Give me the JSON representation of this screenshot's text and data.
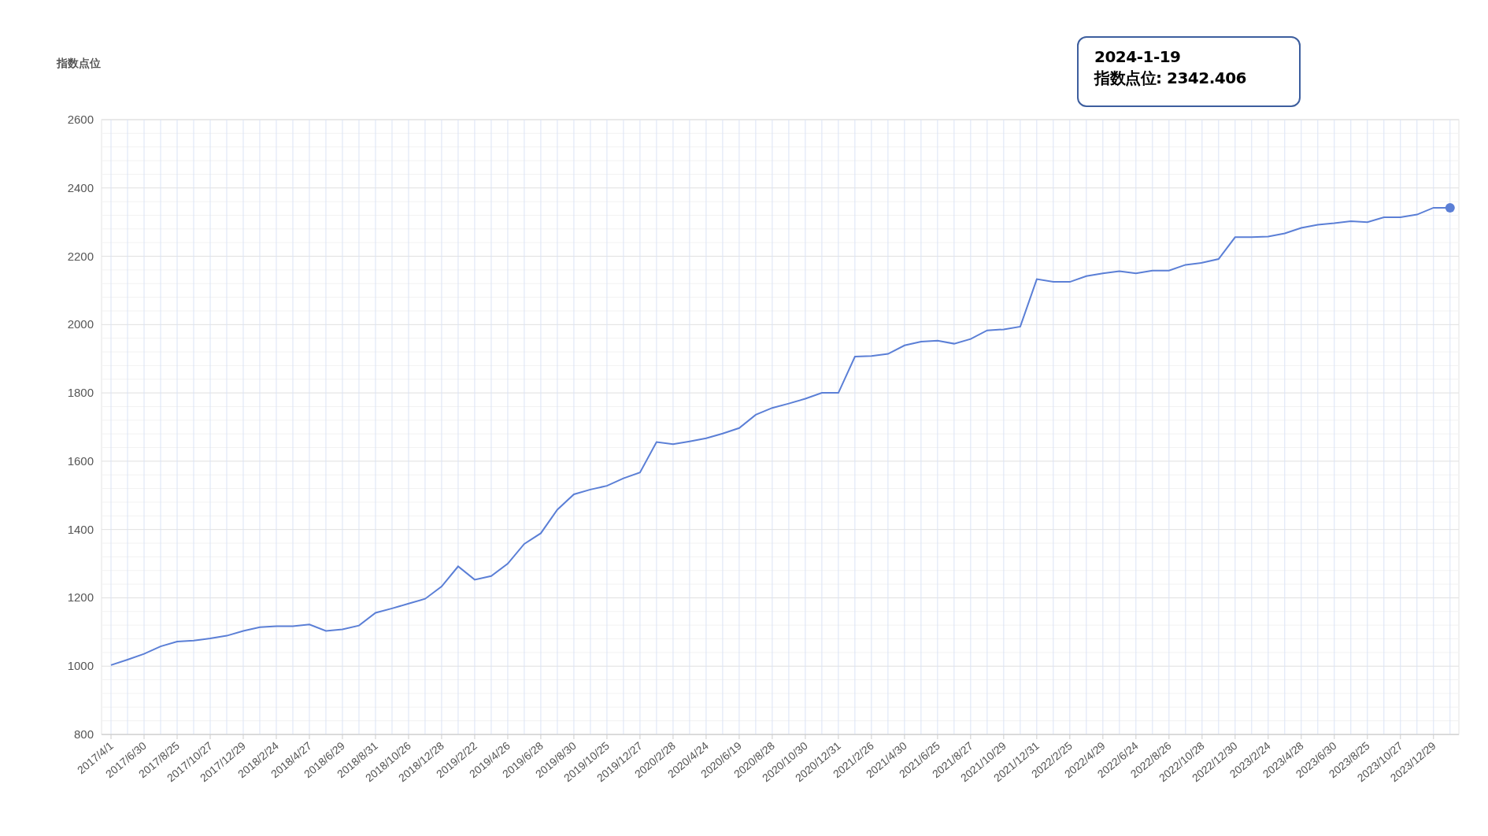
{
  "chart": {
    "chart_data": {
      "type": "line",
      "ylabel": "指数点位",
      "categories": [
        "2017/4/1",
        null,
        "2017/6/30",
        null,
        "2017/8/25",
        null,
        "2017/10/27",
        null,
        "2017/12/29",
        null,
        "2018/2/24",
        null,
        "2018/4/27",
        null,
        "2018/6/29",
        null,
        "2018/8/31",
        null,
        "2018/10/26",
        null,
        "2018/12/28",
        null,
        "2019/2/22",
        null,
        "2019/4/26",
        null,
        "2019/6/28",
        null,
        "2019/8/30",
        null,
        "2019/10/25",
        null,
        "2019/12/27",
        null,
        "2020/2/28",
        null,
        "2020/4/24",
        null,
        "2020/6/19",
        null,
        "2020/8/28",
        null,
        "2020/10/30",
        null,
        "2020/12/31",
        null,
        "2021/2/26",
        null,
        "2021/4/30",
        null,
        "2021/6/25",
        null,
        "2021/8/27",
        null,
        "2021/10/29",
        null,
        "2021/12/31",
        null,
        "2022/2/25",
        null,
        "2022/4/29",
        null,
        "2022/6/24",
        null,
        "2022/8/26",
        null,
        "2022/10/28",
        null,
        "2022/12/30",
        null,
        "2023/2/24",
        null,
        "2023/4/28",
        null,
        "2023/6/30",
        null,
        "2023/8/25",
        null,
        "2023/10/27",
        null,
        "2023/12/29",
        null
      ],
      "series": [
        {
          "color": "#5b7fd6",
          "values": [
            1003,
            1019,
            1036,
            1058,
            1072,
            1075,
            1081,
            1089,
            1103,
            1114,
            1117,
            1117,
            1122,
            1103,
            1108,
            1119,
            1156,
            1169,
            1183,
            1197,
            1233,
            1292,
            1253,
            1264,
            1300,
            1358,
            1389,
            1458,
            1503,
            1517,
            1528,
            1550,
            1567,
            1656,
            1650,
            1658,
            1667,
            1681,
            1697,
            1736,
            1756,
            1769,
            1783,
            1800,
            1800,
            1906,
            1908,
            1914,
            1939,
            1950,
            1953,
            1944,
            1958,
            1983,
            1986,
            1994,
            2133,
            2125,
            2125,
            2142,
            2150,
            2156,
            2150,
            2158,
            2158,
            2175,
            2181,
            2192,
            2256,
            2256,
            2258,
            2267,
            2283,
            2292,
            2297,
            2303,
            2300,
            2314,
            2314,
            2322,
            2342,
            2342
          ]
        }
      ],
      "ylim": [
        800,
        2600
      ],
      "grid": true,
      "yticks": [
        800,
        1000,
        1200,
        1400,
        1600,
        1800,
        2000,
        2200,
        2400,
        2600
      ]
    },
    "tooltip": {
      "date": "2024-1-19",
      "text": "指数点位: 2342.406"
    }
  }
}
